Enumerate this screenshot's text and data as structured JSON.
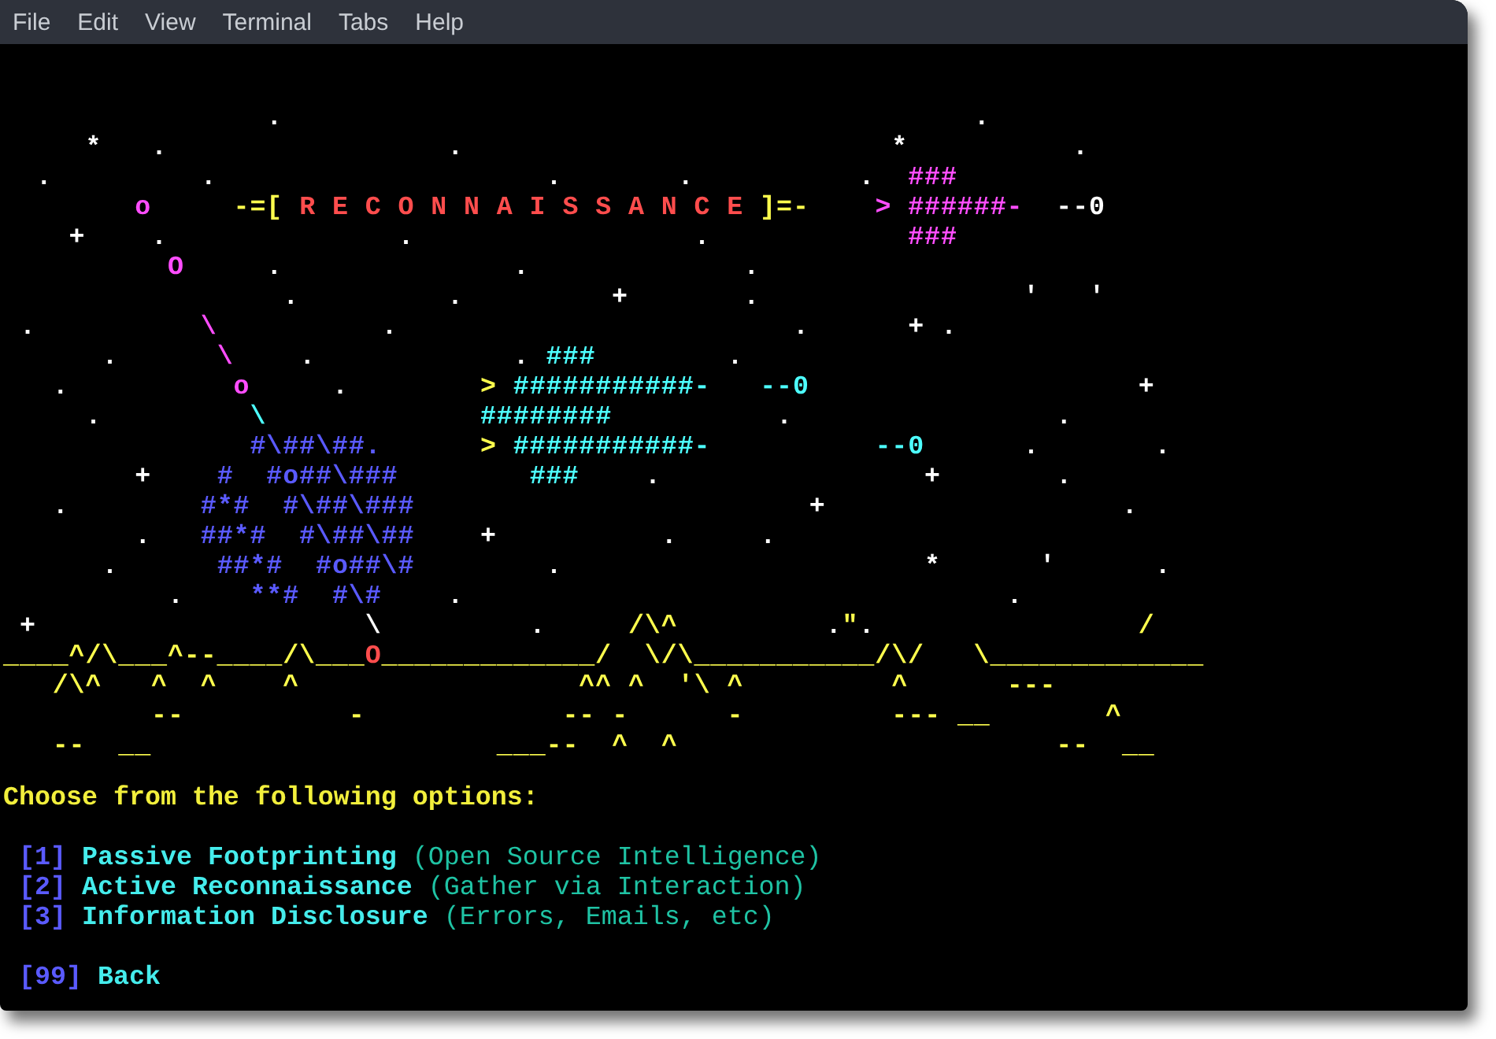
{
  "menu_bar": [
    "File",
    "Edit",
    "View",
    "Terminal",
    "Tabs",
    "Help"
  ],
  "terminal": {
    "art": [
      [
        {
          "text": "                .",
          "color": "#ffffff"
        },
        {
          "text": "                                          .",
          "color": "#ffffff"
        }
      ],
      [
        {
          "text": "     *",
          "color": "#ffffff"
        },
        {
          "text": "   .",
          "color": "#ffffff"
        },
        {
          "text": "                 .",
          "color": "#ffffff"
        },
        {
          "text": "                          *",
          "color": "#ffffff"
        },
        {
          "text": "          .",
          "color": "#ffffff"
        }
      ],
      [
        {
          "text": "  .",
          "color": "#ffffff"
        },
        {
          "text": "         .",
          "color": "#ffffff"
        },
        {
          "text": "                    .",
          "color": "#ffffff"
        },
        {
          "text": "       .",
          "color": "#ffffff"
        },
        {
          "text": "          .",
          "color": "#ffffff"
        },
        {
          "text": "  ###",
          "color": "#ff4dff"
        }
      ],
      [
        {
          "text": "        o",
          "color": "#ff4dff"
        },
        {
          "text": "     -=[",
          "color": "#ffff4d"
        },
        {
          "text": " R E C O N N A I S S A N C E",
          "color": "#ff4d4d"
        },
        {
          "text": " ]=-",
          "color": "#ffff4d"
        },
        {
          "text": "    >",
          "color": "#ff4dff"
        },
        {
          "text": " ######-",
          "color": "#ff4dff"
        },
        {
          "text": "  --0",
          "color": "#ffffff"
        }
      ],
      [
        {
          "text": "    +",
          "color": "#ffffff"
        },
        {
          "text": "    .",
          "color": "#ffffff"
        },
        {
          "text": "              .",
          "color": "#ffffff"
        },
        {
          "text": "                 .",
          "color": "#ffffff"
        },
        {
          "text": "            ###",
          "color": "#ff4dff"
        }
      ],
      [
        {
          "text": "          O",
          "color": "#ff4dff"
        },
        {
          "text": "     .",
          "color": "#ffffff"
        },
        {
          "text": "              .",
          "color": "#ffffff"
        },
        {
          "text": "             .",
          "color": "#ffffff"
        }
      ],
      [
        {
          "text": "                 .",
          "color": "#ffffff"
        },
        {
          "text": "         .",
          "color": "#ffffff"
        },
        {
          "text": "         +",
          "color": "#ffffff"
        },
        {
          "text": "       .",
          "color": "#ffffff"
        },
        {
          "text": "                '",
          "color": "#ffffff"
        },
        {
          "text": "   '",
          "color": "#ffffff"
        }
      ],
      [
        {
          "text": " .",
          "color": "#ffffff"
        },
        {
          "text": "          \\",
          "color": "#ff4dff"
        },
        {
          "text": "          .",
          "color": "#ffffff"
        },
        {
          "text": "                        .",
          "color": "#ffffff"
        },
        {
          "text": "      +",
          "color": "#ffffff"
        },
        {
          "text": " .",
          "color": "#ffffff"
        }
      ],
      [
        {
          "text": "      .",
          "color": "#ffffff"
        },
        {
          "text": "      \\",
          "color": "#ff4dff"
        },
        {
          "text": "    .",
          "color": "#ffffff"
        },
        {
          "text": "            .",
          "color": "#ffffff"
        },
        {
          "text": " ###",
          "color": "#4dffff"
        },
        {
          "text": "        .",
          "color": "#ffffff"
        }
      ],
      [
        {
          "text": "   .",
          "color": "#ffffff"
        },
        {
          "text": "          o",
          "color": "#ff4dff"
        },
        {
          "text": "     .",
          "color": "#ffffff"
        },
        {
          "text": "        >",
          "color": "#ffff4d"
        },
        {
          "text": " ###########-",
          "color": "#4dffff"
        },
        {
          "text": "   --0",
          "color": "#4dffff"
        },
        {
          "text": "                    +",
          "color": "#ffffff"
        }
      ],
      [
        {
          "text": "     .",
          "color": "#ffffff"
        },
        {
          "text": "         \\",
          "color": "#4dffff"
        },
        {
          "text": "             ########",
          "color": "#4dffff"
        },
        {
          "text": "          .",
          "color": "#ffffff"
        },
        {
          "text": "                .",
          "color": "#ffffff"
        }
      ],
      [
        {
          "text": "               #\\##\\##.",
          "color": "#5a5aff"
        },
        {
          "text": "      >",
          "color": "#ffff4d"
        },
        {
          "text": " ###########-",
          "color": "#4dffff"
        },
        {
          "text": "          --0",
          "color": "#4dffff"
        },
        {
          "text": "      .",
          "color": "#ffffff"
        },
        {
          "text": "       .",
          "color": "#ffffff"
        }
      ],
      [
        {
          "text": "        +",
          "color": "#ffffff"
        },
        {
          "text": "    #  #o##\\###",
          "color": "#5a5aff"
        },
        {
          "text": "        ###",
          "color": "#4dffff"
        },
        {
          "text": "    .",
          "color": "#ffffff"
        },
        {
          "text": "                +",
          "color": "#ffffff"
        },
        {
          "text": "       .",
          "color": "#ffffff"
        }
      ],
      [
        {
          "text": "   .",
          "color": "#ffffff"
        },
        {
          "text": "        #*#  #\\##\\###",
          "color": "#5a5aff"
        },
        {
          "text": "                        +",
          "color": "#ffffff"
        },
        {
          "text": "                  .",
          "color": "#ffffff"
        }
      ],
      [
        {
          "text": "        .",
          "color": "#ffffff"
        },
        {
          "text": "   ##*#  #\\##\\##",
          "color": "#5a5aff"
        },
        {
          "text": "    +",
          "color": "#ffffff"
        },
        {
          "text": "          .",
          "color": "#ffffff"
        },
        {
          "text": "     .",
          "color": "#ffffff"
        }
      ],
      [
        {
          "text": "      .",
          "color": "#ffffff"
        },
        {
          "text": "      ##*#  #o##\\#",
          "color": "#5a5aff"
        },
        {
          "text": "        .",
          "color": "#ffffff"
        },
        {
          "text": "                      *",
          "color": "#ffffff"
        },
        {
          "text": "      '",
          "color": "#ffffff"
        },
        {
          "text": "      .",
          "color": "#ffffff"
        }
      ],
      [
        {
          "text": "          .",
          "color": "#ffffff"
        },
        {
          "text": "    **#  #\\#",
          "color": "#5a5aff"
        },
        {
          "text": "    .",
          "color": "#ffffff"
        },
        {
          "text": "                                 .",
          "color": "#ffffff"
        }
      ],
      [
        {
          "text": " +",
          "color": "#ffffff"
        },
        {
          "text": "                    \\",
          "color": "#ffffff"
        },
        {
          "text": "         .",
          "color": "#ffffff"
        },
        {
          "text": "     /\\^",
          "color": "#ffff4d"
        },
        {
          "text": "         .",
          "color": "#ffffff"
        },
        {
          "text": "\"",
          "color": "#ffff4d"
        },
        {
          "text": ".",
          "color": "#ffffff"
        },
        {
          "text": "                /",
          "color": "#ffff4d"
        }
      ],
      [
        {
          "text": "____^/\\___^--____/\\___",
          "color": "#ffff4d"
        },
        {
          "text": "O",
          "color": "#ff4d4d"
        },
        {
          "text": "_____________/  \\/\\___________/\\/   \\_____________",
          "color": "#ffff4d"
        }
      ],
      [
        {
          "text": "   /\\^",
          "color": "#ffff4d"
        },
        {
          "text": "   ^",
          "color": "#ffff4d"
        },
        {
          "text": "  ^",
          "color": "#ffff4d"
        },
        {
          "text": "    ^",
          "color": "#ffff4d"
        },
        {
          "text": "                 ^^",
          "color": "#ffff4d"
        },
        {
          "text": " ^",
          "color": "#ffff4d"
        },
        {
          "text": "  '\\",
          "color": "#ffff4d"
        },
        {
          "text": " ^",
          "color": "#ffff4d"
        },
        {
          "text": "         ^",
          "color": "#ffff4d"
        },
        {
          "text": "      ---",
          "color": "#ffff4d"
        }
      ],
      [
        {
          "text": "         --",
          "color": "#ffff4d"
        },
        {
          "text": "          -",
          "color": "#ffff4d"
        },
        {
          "text": "            --",
          "color": "#ffff4d"
        },
        {
          "text": " -",
          "color": "#ffff4d"
        },
        {
          "text": "      -",
          "color": "#ffff4d"
        },
        {
          "text": "         ---",
          "color": "#ffff4d"
        },
        {
          "text": " __",
          "color": "#ffff4d"
        },
        {
          "text": "       ^",
          "color": "#ffff4d"
        }
      ],
      [
        {
          "text": "   --",
          "color": "#ffff4d"
        },
        {
          "text": "  __",
          "color": "#ffff4d"
        },
        {
          "text": "                     ___",
          "color": "#ffff4d"
        },
        {
          "text": "--",
          "color": "#ffff4d"
        },
        {
          "text": "  ^",
          "color": "#ffff4d"
        },
        {
          "text": "  ^",
          "color": "#ffff4d"
        },
        {
          "text": "                       --",
          "color": "#ffff4d"
        },
        {
          "text": "  __",
          "color": "#ffff4d"
        }
      ]
    ],
    "menu": {
      "prompt": "Choose from the following options:",
      "options": [
        {
          "key": "[1]",
          "title": "Passive Footprinting",
          "note": "(Open Source Intelligence)"
        },
        {
          "key": "[2]",
          "title": "Active Reconnaissance",
          "note": "(Gather via Interaction)"
        },
        {
          "key": "[3]",
          "title": "Information Disclosure",
          "note": "(Errors, Emails, etc)"
        }
      ],
      "back": {
        "key": "[99]",
        "title": "Back"
      }
    }
  }
}
